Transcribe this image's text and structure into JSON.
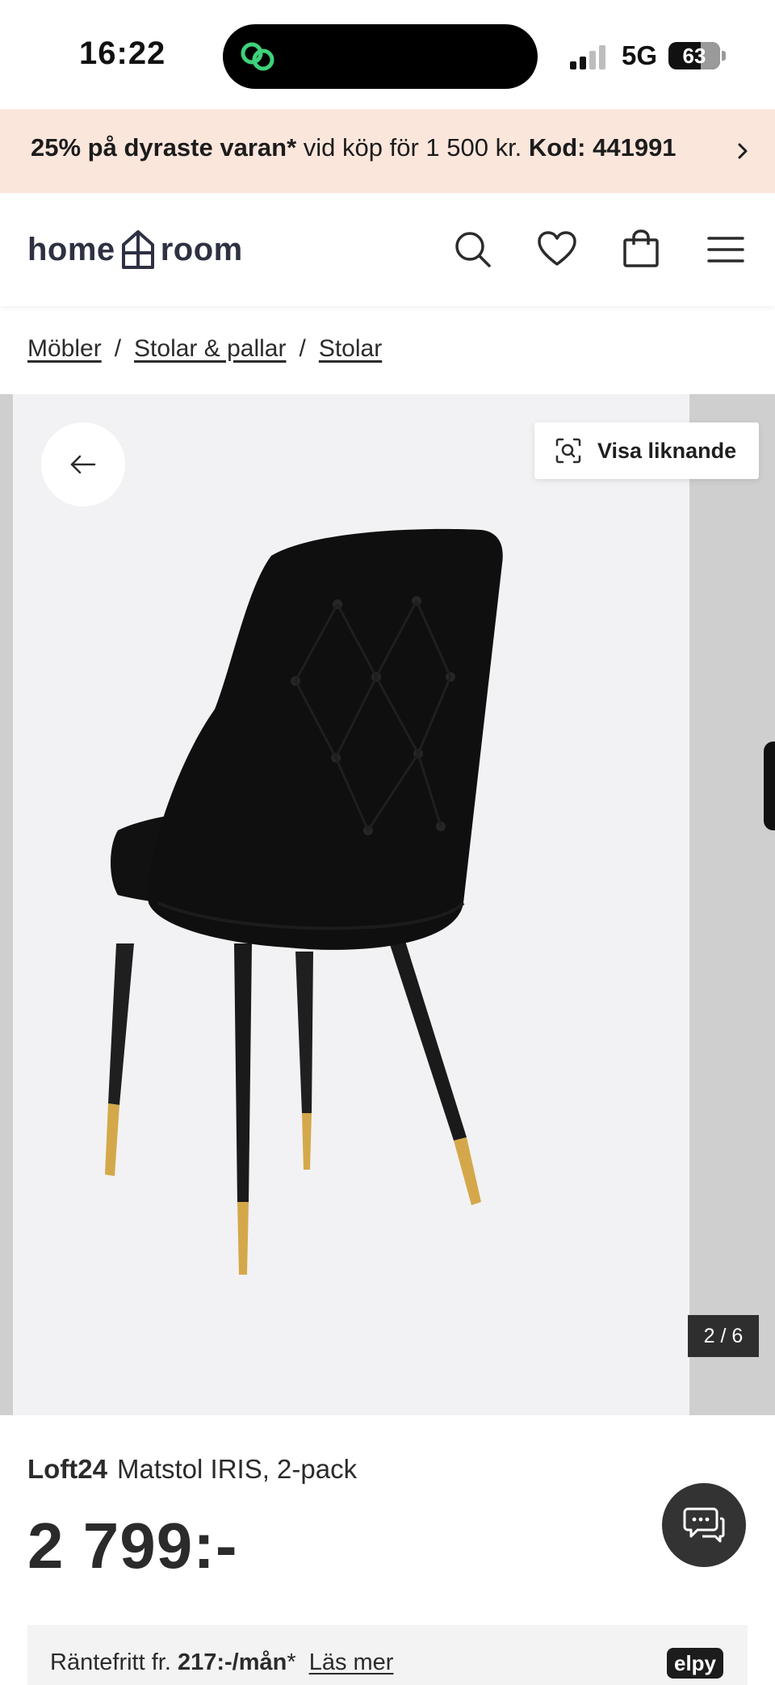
{
  "status_bar": {
    "time": "16:22",
    "network": "5G",
    "battery_level": "63",
    "battery_fraction": 0.63
  },
  "promo": {
    "bold_1": "25% på dyraste varan*",
    "text": " vid köp för 1 500 kr. ",
    "bold_2": "Kod: 441991"
  },
  "header": {
    "logo_left": "home",
    "logo_right": "room"
  },
  "breadcrumb": {
    "items": [
      "Möbler",
      "Stolar & pallar",
      "Stolar"
    ],
    "separator": "/"
  },
  "gallery": {
    "similar_label": "Visa liknande",
    "counter": "2 / 6"
  },
  "product": {
    "brand": "Loft24",
    "name": "Matstol IRIS, 2-pack",
    "price": "2 799:-"
  },
  "financing": {
    "prefix": "Räntefritt fr. ",
    "amount": "217:-/mån",
    "suffix": "* ",
    "link": "Läs mer",
    "provider": "elpy"
  },
  "colors": {
    "promo_bg": "#fbe6dc",
    "logo": "#2e3142",
    "text": "#2b2b2b",
    "gallery_bg": "#f2f2f4",
    "chair_gold": "#d4a84a"
  }
}
